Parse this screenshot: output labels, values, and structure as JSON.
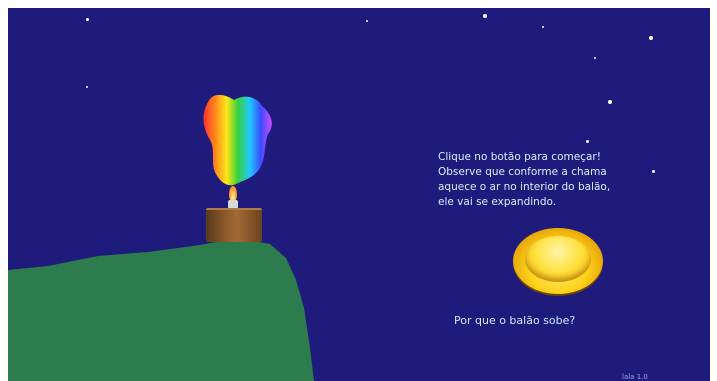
{
  "scene": {
    "instructions": "Clique no botão para começar!\n Observe que conforme a chama\n aquece o ar no interior do balão,\n ele vai se expandindo.",
    "question_link": "Por que o balão sobe?",
    "footer": "lala 1.0",
    "start_button_icon": "round-yellow-button-icon"
  },
  "colors": {
    "sky": "#1f1b7c",
    "hill": "#2d7c4e",
    "text": "#d8f0ff"
  }
}
